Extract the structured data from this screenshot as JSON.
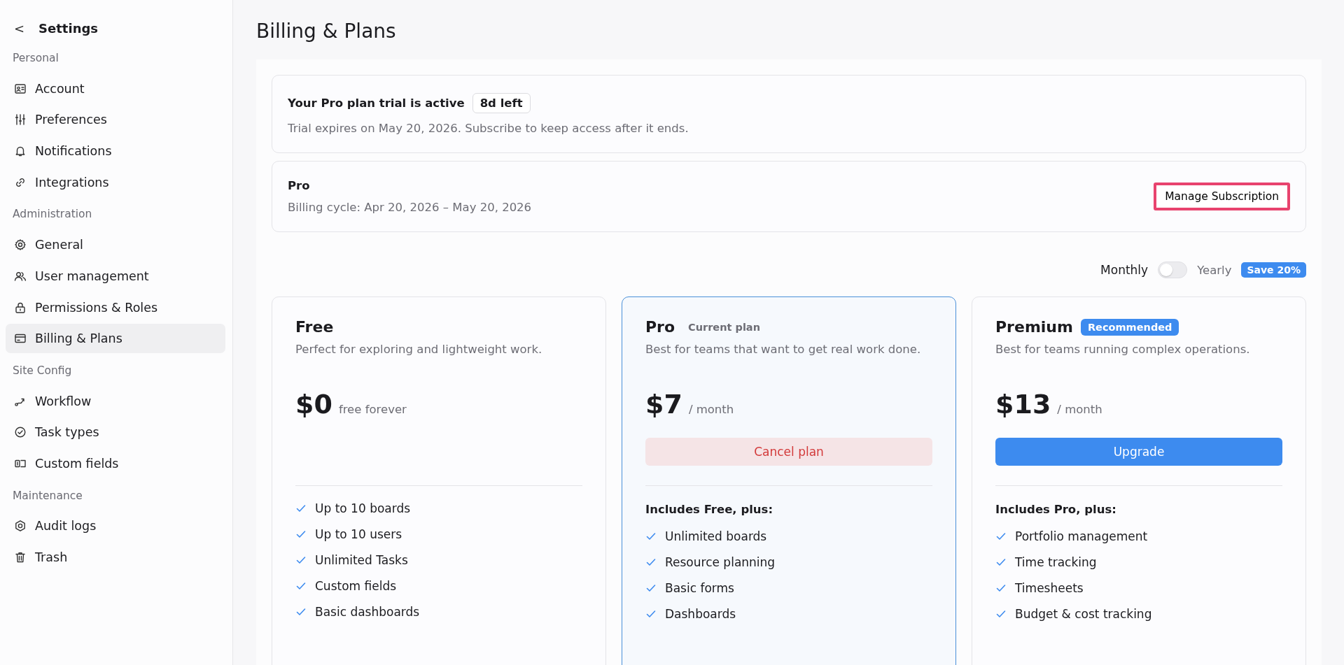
{
  "sidebar": {
    "back": "<",
    "title": "Settings",
    "sections": [
      {
        "label": "Personal",
        "items": [
          {
            "label": "Account",
            "selected": false
          },
          {
            "label": "Preferences",
            "selected": false
          },
          {
            "label": "Notifications",
            "selected": false
          },
          {
            "label": "Integrations",
            "selected": false
          }
        ]
      },
      {
        "label": "Administration",
        "items": [
          {
            "label": "General",
            "selected": false
          },
          {
            "label": "User management",
            "selected": false
          },
          {
            "label": "Permissions & Roles",
            "selected": false
          },
          {
            "label": "Billing & Plans",
            "selected": true
          }
        ]
      },
      {
        "label": "Site Config",
        "items": [
          {
            "label": "Workflow",
            "selected": false
          },
          {
            "label": "Task types",
            "selected": false
          },
          {
            "label": "Custom fields",
            "selected": false
          }
        ]
      },
      {
        "label": "Maintenance",
        "items": [
          {
            "label": "Audit logs",
            "selected": false
          },
          {
            "label": "Trash",
            "selected": false
          }
        ]
      }
    ]
  },
  "page_title": "Billing & Plans",
  "trial": {
    "title": "Your Pro plan trial is active",
    "badge": "8d left",
    "text": "Trial expires on May 20, 2026. Subscribe to keep access after it ends."
  },
  "subscription": {
    "plan": "Pro",
    "cycle": "Billing cycle: Apr 20, 2026 – May 20, 2026",
    "button": "Manage Subscription"
  },
  "billing_toggle": {
    "left": "Monthly",
    "right": "Yearly",
    "on": false,
    "badge": "Save 20%"
  },
  "plans": [
    {
      "name": "Free",
      "selected": false,
      "description": "Perfect for exploring and lightweight work.",
      "price": "$0",
      "period": "free forever",
      "features": [
        "Up to 10 boards",
        "Up to 10 users",
        "Unlimited Tasks",
        "Custom fields",
        "Basic dashboards"
      ]
    },
    {
      "name": "Pro",
      "selected": true,
      "tag": {
        "kind": "plain",
        "text": "Current plan"
      },
      "description": "Best for teams that want to get real work done.",
      "price": "$7",
      "period": "/ month",
      "button": {
        "kind": "danger",
        "label": "Cancel plan"
      },
      "features_heading": "Includes Free, plus:",
      "features": [
        "Unlimited boards",
        "Resource planning",
        "Basic forms",
        "Dashboards"
      ]
    },
    {
      "name": "Premium",
      "selected": false,
      "tag": {
        "kind": "badge",
        "text": "Recommended"
      },
      "description": "Best for teams running complex operations.",
      "price": "$13",
      "period": "/ month",
      "button": {
        "kind": "primary",
        "label": "Upgrade"
      },
      "features_heading": "Includes Pro, plus:",
      "features": [
        "Portfolio management",
        "Time tracking",
        "Timesheets",
        "Budget & cost tracking"
      ]
    }
  ]
}
